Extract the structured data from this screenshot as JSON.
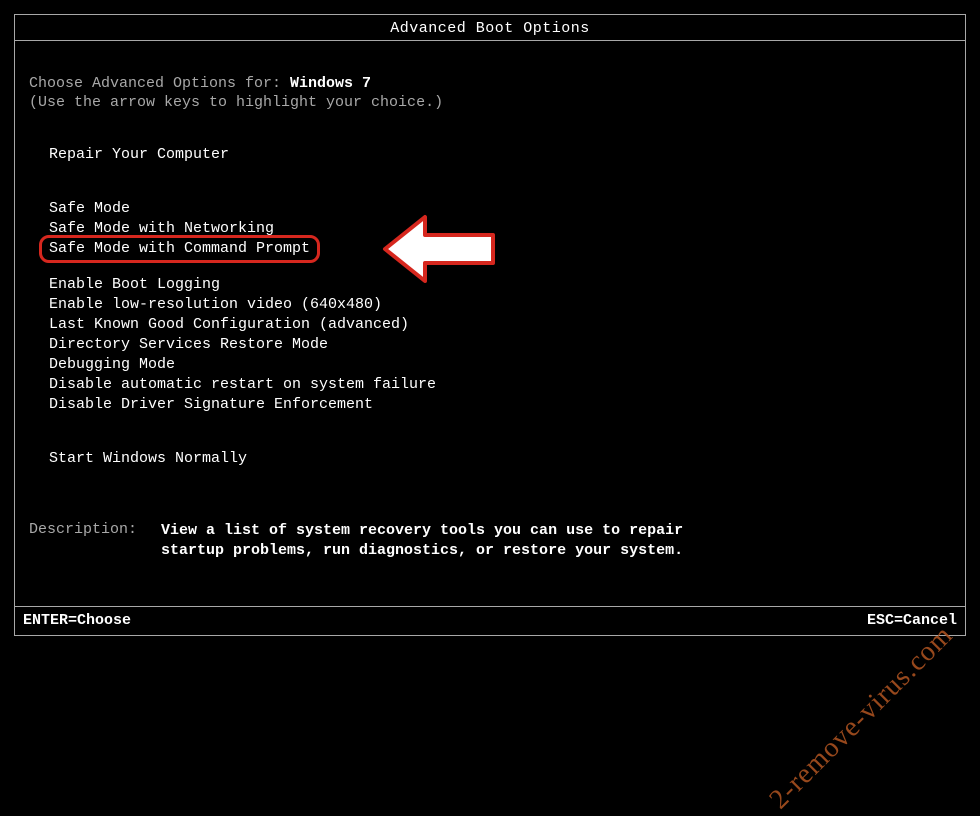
{
  "title": "Advanced Boot Options",
  "choose_prefix": "Choose Advanced Options for: ",
  "os_name": "Windows 7",
  "hint": "(Use the arrow keys to highlight your choice.)",
  "menu": {
    "group1": [
      "Repair Your Computer"
    ],
    "group2": [
      "Safe Mode",
      "Safe Mode with Networking",
      "Safe Mode with Command Prompt"
    ],
    "group3": [
      "Enable Boot Logging",
      "Enable low-resolution video (640x480)",
      "Last Known Good Configuration (advanced)",
      "Directory Services Restore Mode",
      "Debugging Mode",
      "Disable automatic restart on system failure",
      "Disable Driver Signature Enforcement"
    ],
    "group4": [
      "Start Windows Normally"
    ]
  },
  "description": {
    "label": "Description:",
    "line1": "View a list of system recovery tools you can use to repair",
    "line2": "startup problems, run diagnostics, or restore your system."
  },
  "footer": {
    "left": "ENTER=Choose",
    "right": "ESC=Cancel"
  },
  "watermark": "2-remove-virus.com"
}
